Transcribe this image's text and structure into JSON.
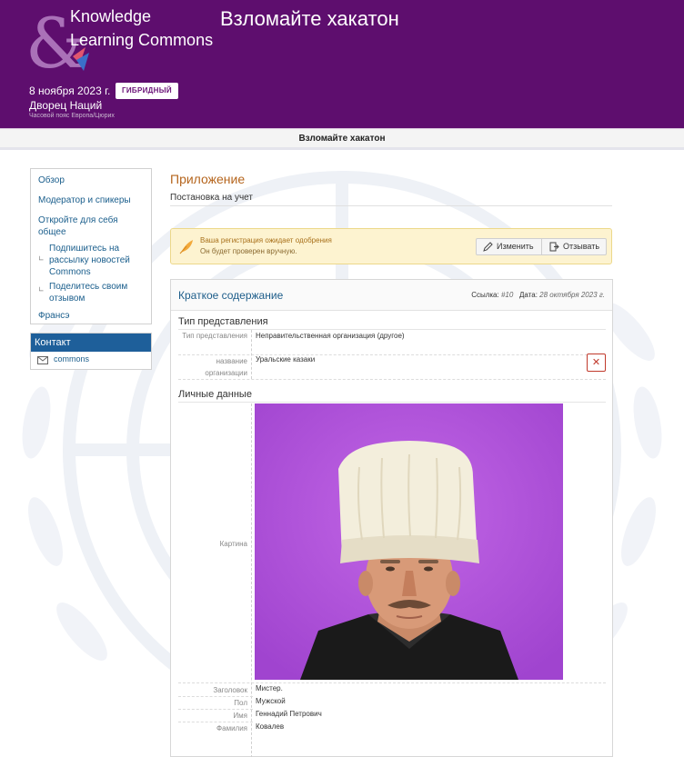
{
  "header": {
    "logo_line1": "Knowledge",
    "logo_line2": "Learning Commons",
    "event_title": "Взломайте хакатон",
    "date": "8 ноября 2023 г.",
    "format_badge": "ГИБРИДНЫЙ",
    "venue": "Дворец Наций",
    "timezone": "Часовой пояс Европа/Цюрих",
    "colors": {
      "brand": "#5e0e6e",
      "accent": "#b5651d",
      "link": "#1a5e8c"
    }
  },
  "subnav": {
    "title": "Взломайте хакатон"
  },
  "sidebar": {
    "items": [
      {
        "label": "Обзор"
      },
      {
        "label": "Модератор и спикеры"
      },
      {
        "label": "Откройте для себя общее"
      },
      {
        "label": "Подпишитесь на рассылку новостей Commons"
      },
      {
        "label": "Поделитесь своим отзывом"
      },
      {
        "label": "Франсэ"
      }
    ],
    "contact_title": "Контакт",
    "contact_email": "commons"
  },
  "main": {
    "heading": "Приложение",
    "subheading": "Постановка на учет",
    "alert": {
      "title": "Ваша регистрация ожидает одобрения",
      "text": "Он будет проверен вручную.",
      "edit_label": "Изменить",
      "withdraw_label": "Отзывать"
    },
    "summary": {
      "title": "Краткое содержание",
      "ref_label": "Ссылка:",
      "ref_value": "#10",
      "date_label": "Дата:",
      "date_value": "28 октября 2023 г.",
      "section1_title": "Тип представления",
      "type_label": "Тип представления",
      "type_value": "Неправительственная организация (другое)",
      "org_label": "название организации",
      "org_value": "Уральские казаки",
      "section2_title": "Личные данные",
      "photo_label": "Картина",
      "fields": [
        {
          "label": "Заголовок",
          "value": "Мистер."
        },
        {
          "label": "Пол",
          "value": "Мужской"
        },
        {
          "label": "Имя",
          "value": "Геннадий Петрович"
        },
        {
          "label": "Фамилия",
          "value": "Ковалев"
        }
      ]
    }
  }
}
